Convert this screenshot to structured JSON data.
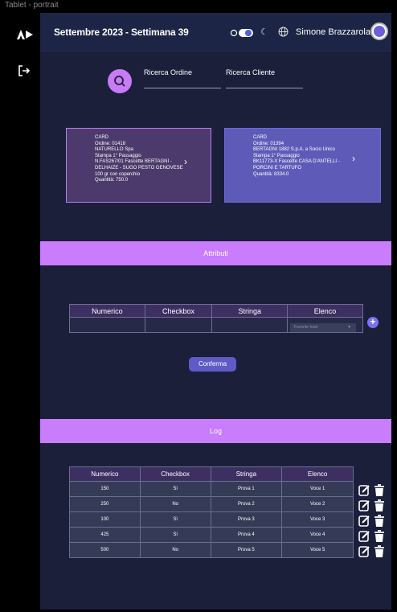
{
  "window_title": "Tablet - portrait",
  "topbar": {
    "title": "Settembre 2023 - Settimana 39",
    "username": "Simone Brazzarola"
  },
  "search": {
    "order_label": "Ricerca Ordine",
    "client_label": "Ricerca Cliente"
  },
  "cards": [
    {
      "lines": [
        "CARD",
        "Ordine: 01418",
        "NATURELLO Spa",
        "Stampa 1° Passaggio",
        "N.FAS267/01 Fascette BERTAGNI -",
        "DELHAIZE - SUGO PESTO GENOVESE",
        "100 gr con coperchio",
        "Quantità: 750.0"
      ]
    },
    {
      "lines": [
        "CARD",
        "Ordine: 01394",
        "BERTAGNI 1882 S.p.A. a Socio Unico",
        "Stampa 1° Passaggio",
        "BK11773-X Fascette CASA D'ANTELLI -",
        "PORCINI E TARTUFO",
        "Quantità: 8334.0"
      ]
    }
  ],
  "attributes": {
    "section_title": "Attributi",
    "columns": [
      "Numerico",
      "Checkbox",
      "Stringa",
      "Elenco"
    ],
    "elenco_placeholder": "Favorite food",
    "confirm_label": "Conferma"
  },
  "log": {
    "section_title": "Log",
    "columns": [
      "Numerico",
      "Checkbox",
      "Stringa",
      "Elenco"
    ],
    "rows": [
      [
        "150",
        "Sì",
        "Prova 1",
        "Voce 1"
      ],
      [
        "250",
        "No",
        "Prova 2",
        "Voce 2"
      ],
      [
        "100",
        "Sì",
        "Prova 3",
        "Voce 3"
      ],
      [
        "425",
        "Sì",
        "Prova 4",
        "Voce 4"
      ],
      [
        "500",
        "No",
        "Prova 5",
        "Voce 5"
      ]
    ]
  },
  "colors": {
    "accent": "#c97cfc",
    "primary": "#5e5bc6",
    "background": "#1b1f3a"
  }
}
